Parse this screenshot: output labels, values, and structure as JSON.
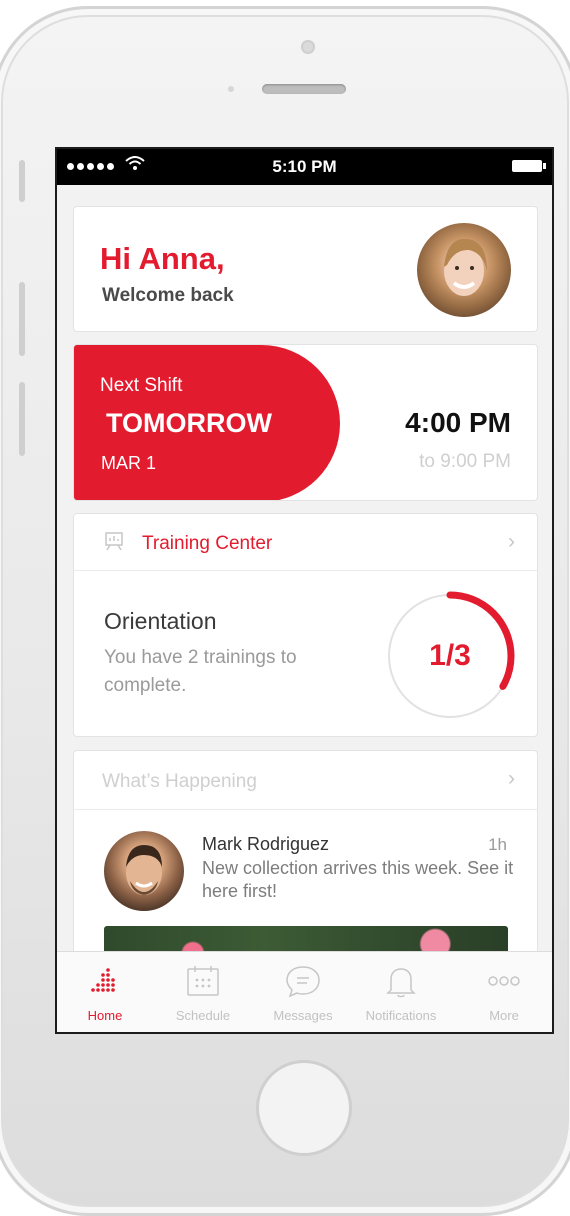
{
  "status_bar": {
    "time": "5:10 PM"
  },
  "greeting": {
    "title": "Hi Anna,",
    "subtitle": "Welcome back"
  },
  "shift": {
    "label": "Next Shift",
    "day": "TOMORROW",
    "date": "MAR 1",
    "start": "4:00 PM",
    "end": "to 9:00 PM"
  },
  "training": {
    "header": "Training Center",
    "name": "Orientation",
    "description": "You have 2 trainings to complete.",
    "progress_text": "1/3",
    "progress_fraction": 0.333
  },
  "happening": {
    "header": "What’s Happening",
    "post": {
      "author": "Mark Rodriguez",
      "time": "1h",
      "message": "New collection arrives this week. See it here first!"
    }
  },
  "tabs": [
    {
      "label": "Home",
      "icon": "home-dots-icon",
      "active": true
    },
    {
      "label": "Schedule",
      "icon": "calendar-icon",
      "active": false
    },
    {
      "label": "Messages",
      "icon": "chat-bubble-icon",
      "active": false
    },
    {
      "label": "Notifications",
      "icon": "bell-icon",
      "active": false
    },
    {
      "label": "More",
      "icon": "more-dots-icon",
      "active": false
    }
  ],
  "colors": {
    "accent": "#e31b2e",
    "muted": "#c2c2c2",
    "background": "#f2f2f2"
  }
}
